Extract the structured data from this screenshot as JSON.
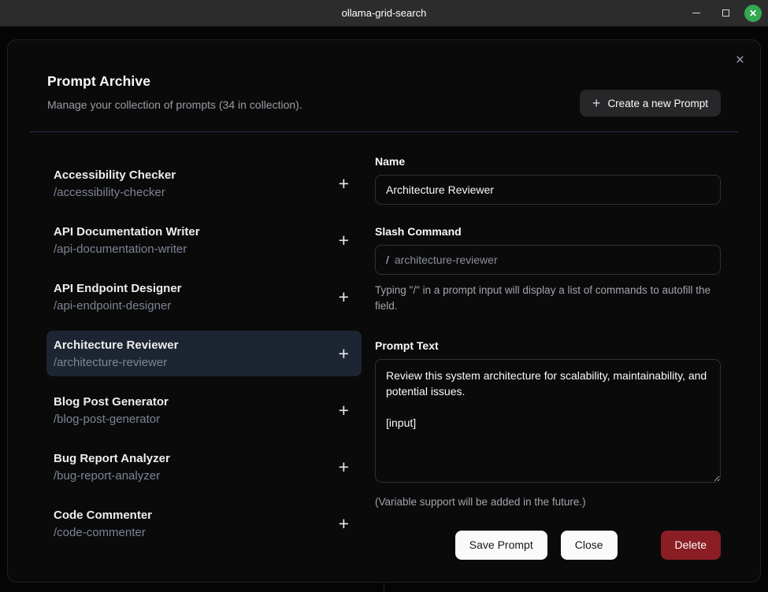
{
  "titlebar": {
    "title": "ollama-grid-search"
  },
  "modal": {
    "title": "Prompt Archive",
    "subtitle": "Manage your collection of prompts (34 in collection).",
    "create_button": "Create a new Prompt",
    "create_plus": "+",
    "close_icon": "×"
  },
  "prompts": [
    {
      "name": "Accessibility Checker",
      "slug": "/accessibility-checker",
      "selected": false
    },
    {
      "name": "API Documentation Writer",
      "slug": "/api-documentation-writer",
      "selected": false
    },
    {
      "name": "API Endpoint Designer",
      "slug": "/api-endpoint-designer",
      "selected": false
    },
    {
      "name": "Architecture Reviewer",
      "slug": "/architecture-reviewer",
      "selected": true
    },
    {
      "name": "Blog Post Generator",
      "slug": "/blog-post-generator",
      "selected": false
    },
    {
      "name": "Bug Report Analyzer",
      "slug": "/bug-report-analyzer",
      "selected": false
    },
    {
      "name": "Code Commenter",
      "slug": "/code-commenter",
      "selected": false
    }
  ],
  "list_plus_icon": "+",
  "form": {
    "name_label": "Name",
    "name_value": "Architecture Reviewer",
    "slash_label": "Slash Command",
    "slash_prefix": "/",
    "slash_value": "architecture-reviewer",
    "slash_help": "Typing \"/\" in a prompt input will display a list of commands to autofill the field.",
    "prompt_label": "Prompt Text",
    "prompt_value": "Review this system architecture for scalability, maintainability, and potential issues.\n\n[input]",
    "prompt_help": "(Variable support will be added in the future.)",
    "buttons": {
      "save": "Save Prompt",
      "close": "Close",
      "delete": "Delete"
    }
  },
  "colors": {
    "close_button_green": "#33a852",
    "destructive_red": "#8b1e24",
    "selected_item_bg": "#1e2532"
  },
  "window_controls": {
    "minimize": "minimize",
    "maximize": "maximize",
    "close": "✕"
  }
}
